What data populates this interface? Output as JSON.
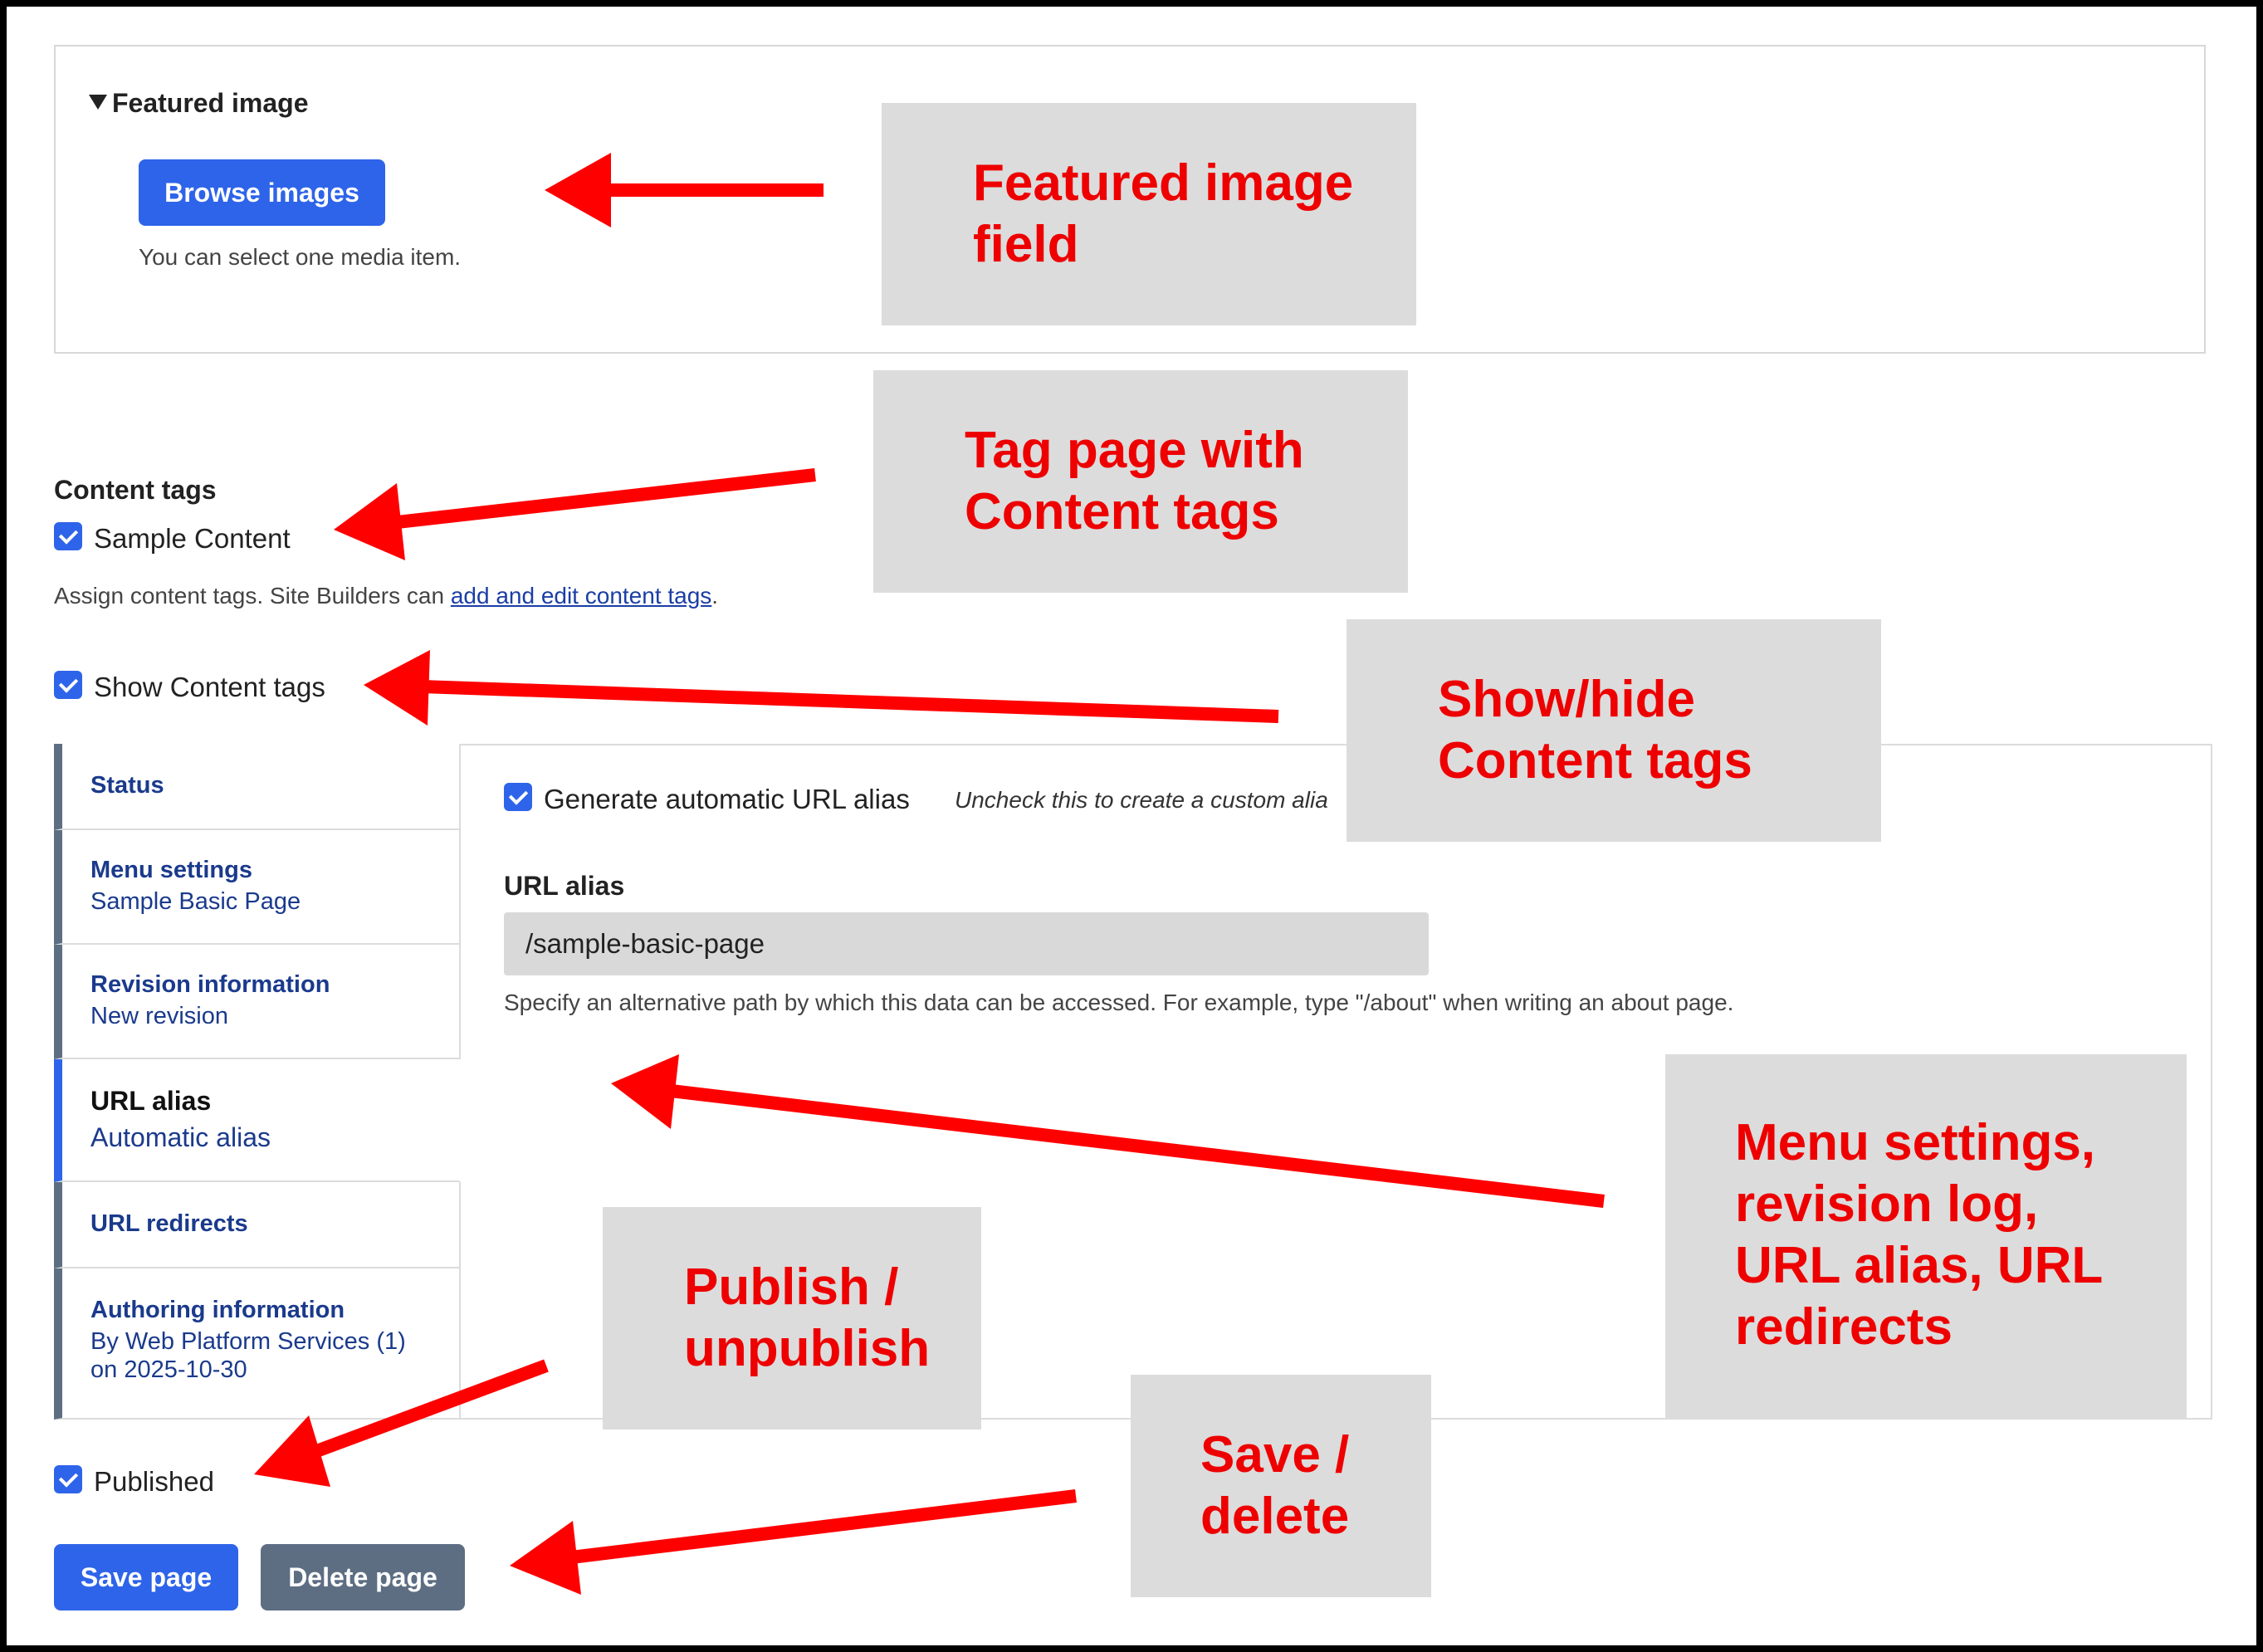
{
  "featured_image": {
    "summary": "Featured image",
    "browse_button": "Browse images",
    "help": "You can select one media item."
  },
  "content_tags": {
    "heading": "Content tags",
    "option": "Sample Content",
    "help_prefix": "Assign content tags. Site Builders can ",
    "help_link": "add and edit content tags",
    "help_suffix": ".",
    "show_toggle": "Show Content tags"
  },
  "vertical_tabs": [
    {
      "title": "Status",
      "summary": ""
    },
    {
      "title": "Menu settings",
      "summary": "Sample Basic Page"
    },
    {
      "title": "Revision information",
      "summary": "New revision"
    },
    {
      "title": "URL alias",
      "summary": "Automatic alias",
      "active": true
    },
    {
      "title": "URL redirects",
      "summary": ""
    },
    {
      "title": "Authoring information",
      "summary": "By Web Platform Services (1)",
      "summary2": "on 2025-10-30"
    }
  ],
  "url_alias": {
    "generate_label": "Generate automatic URL alias",
    "generate_hint": "Uncheck this to create a custom alia",
    "field_label": "URL alias",
    "value": "/sample-basic-page",
    "help": "Specify an alternative path by which this data can be accessed. For example, type \"/about\" when writing an about page."
  },
  "published_label": "Published",
  "actions": {
    "save": "Save page",
    "delete": "Delete page"
  },
  "callouts": {
    "featured": "Featured image\nfield",
    "tags": "Tag page with\nContent tags",
    "show_hide": "Show/hide\nContent tags",
    "menu": "Menu settings,\nrevision log,\nURL alias, URL\nredirects",
    "publish": "Publish /\nunpublish",
    "save": "Save /\ndelete"
  },
  "colors": {
    "primary_button": "#2e64e9",
    "secondary_button": "#5d6e83",
    "annotation_red": "#ee0000",
    "callout_bg": "#dcdcdc"
  }
}
